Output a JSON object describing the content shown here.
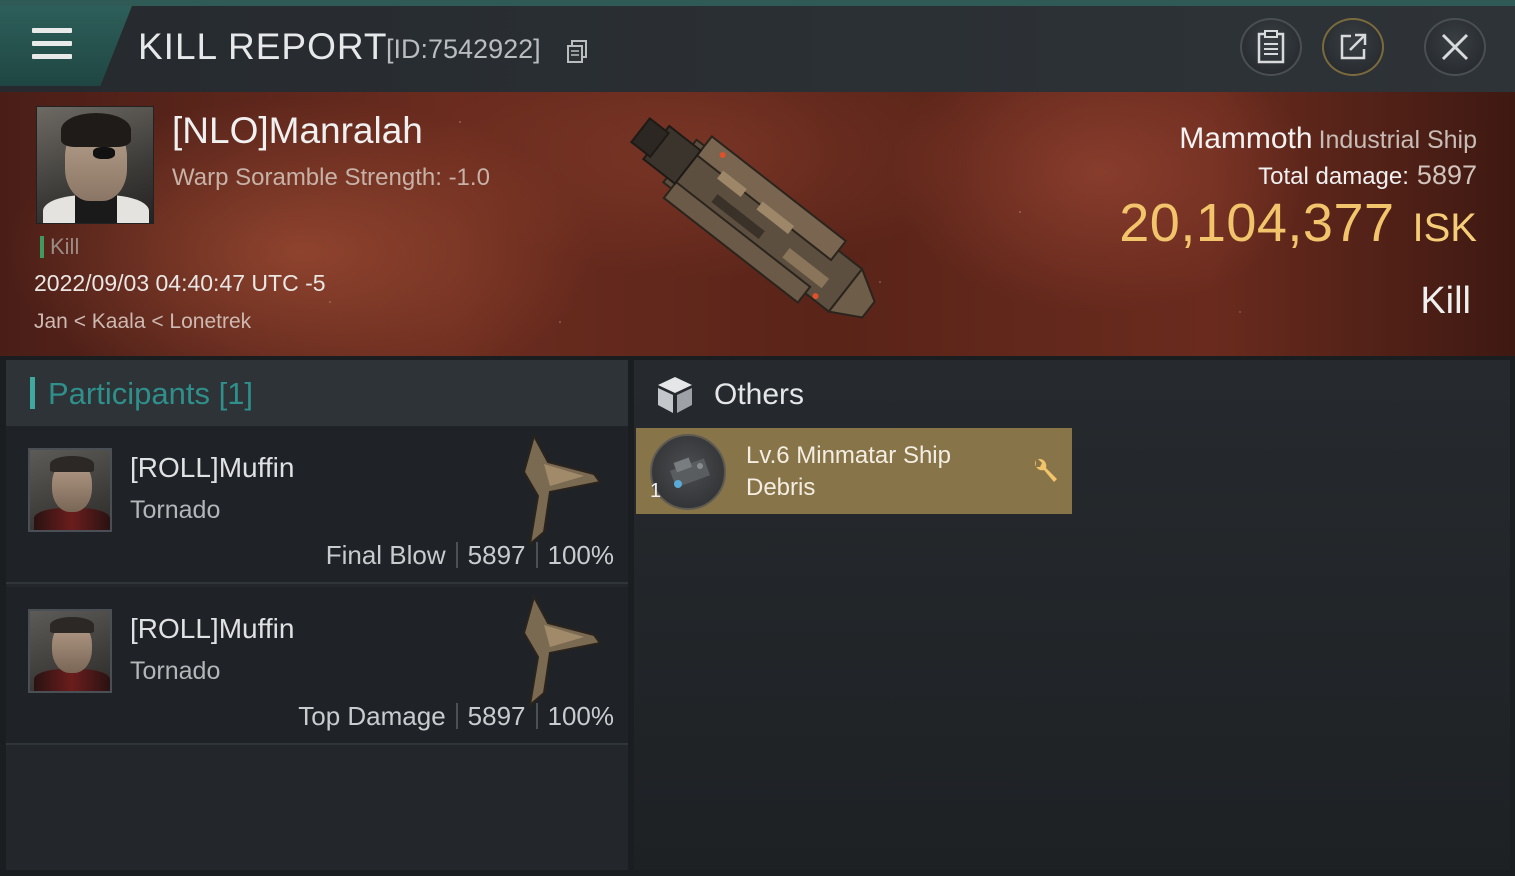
{
  "header": {
    "title": "KILL REPORT",
    "report_id": "[ID:7542922]",
    "icons": [
      "menu-icon",
      "copy-icon",
      "clipboard-icon",
      "share-icon",
      "close-icon"
    ]
  },
  "victim": {
    "name": "[NLO]Manralah",
    "subtitle": "Warp Soramble Strength: -1.0",
    "tag": "Kill",
    "datetime": "2022/09/03 04:40:47 UTC -5",
    "location": "Jan < Kaala < Lonetrek",
    "ship_name": "Mammoth",
    "ship_class": "Industrial Ship",
    "total_damage_label": "Total damage:",
    "total_damage_value": "5897",
    "isk_value": "20,104,377",
    "isk_unit": "ISK",
    "result": "Kill"
  },
  "participants": {
    "header": "Participants [1]",
    "rows": [
      {
        "name": "[ROLL]Muffin",
        "ship": "Tornado",
        "role": "Final Blow",
        "damage": "5897",
        "percent": "100%"
      },
      {
        "name": "[ROLL]Muffin",
        "ship": "Tornado",
        "role": "Top Damage",
        "damage": "5897",
        "percent": "100%"
      }
    ]
  },
  "others": {
    "label": "Others",
    "items": [
      {
        "quantity": "1",
        "name": "Lv.6 Minmatar Ship Debris"
      }
    ]
  },
  "colors": {
    "accent_teal": "#3fa9a0",
    "isk_gold": "#f2c46b",
    "item_card": "#887449",
    "kill_green": "#3e9a5e"
  }
}
